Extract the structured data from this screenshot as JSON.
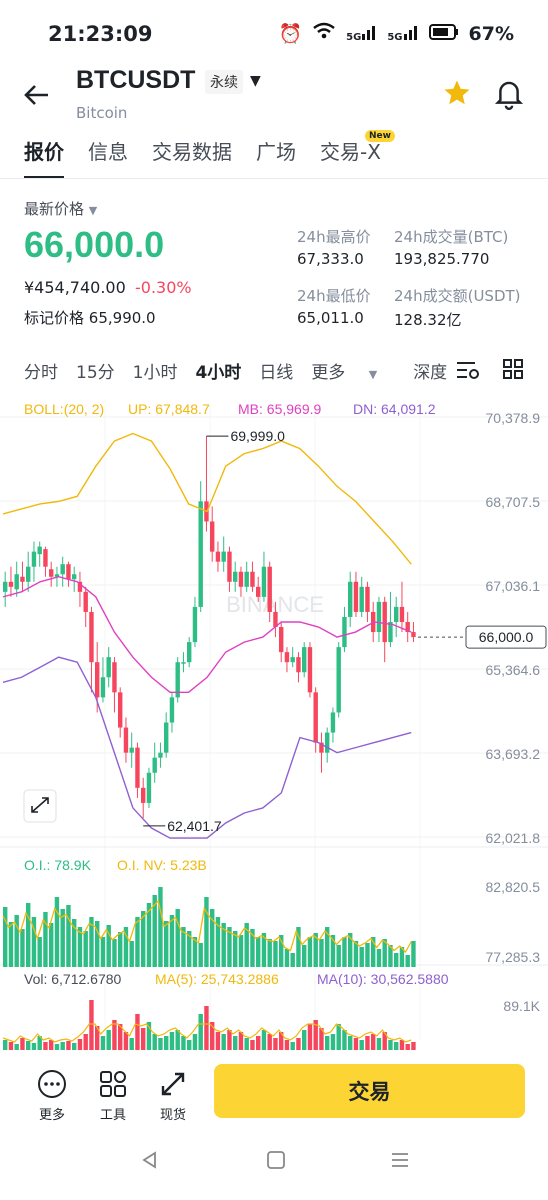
{
  "status": {
    "time": "21:23:09",
    "battery": "67%",
    "net1": "5G",
    "net2": "5G"
  },
  "header": {
    "symbol": "BTCUSDT",
    "contract_type": "永续",
    "name": "Bitcoin"
  },
  "tabs": [
    {
      "label": "报价"
    },
    {
      "label": "信息"
    },
    {
      "label": "交易数据"
    },
    {
      "label": "广场"
    },
    {
      "label": "交易-X"
    }
  ],
  "new_badge": "New",
  "price": {
    "label": "最新价格",
    "last": "66,000.0",
    "cny": "¥454,740.00",
    "change": "-0.30%",
    "mark_label": "标记价格",
    "mark": "65,990.0"
  },
  "stats": {
    "high_label": "24h最高价",
    "high": "67,333.0",
    "low_label": "24h最低价",
    "low": "65,011.0",
    "vol_label": "24h成交量(BTC)",
    "vol": "193,825.770",
    "amt_label": "24h成交额(USDT)",
    "amt": "128.32亿"
  },
  "timeframes": [
    "分时",
    "15分",
    "1小时",
    "4小时",
    "日线",
    "更多",
    "深度"
  ],
  "active_timeframe": "4小时",
  "chart_data": {
    "type": "candlestick",
    "boll": {
      "label": "BOLL:(20, 2)",
      "up": "UP: 67,848.7",
      "mb": "MB: 65,969.9",
      "dn": "DN: 64,091.2"
    },
    "y_ticks": [
      "70,378.9",
      "68,707.5",
      "67,036.1",
      "65,364.6",
      "63,693.2",
      "62,021.8"
    ],
    "ylim": [
      62021.8,
      70378.9
    ],
    "price_marker": "66,000.0",
    "high_annotation": "69,999.0",
    "low_annotation": "62,401.7",
    "watermark": "BINANCE",
    "oi": {
      "oi_label": "O.I.: 78.9K",
      "nv_label": "O.I. NV: 5.23B",
      "ticks": [
        "82,820.5",
        "77,285.3"
      ]
    },
    "volume": {
      "vol_label": "Vol: 6,712.6780",
      "ma5_label": "MA(5): 25,743.2886",
      "ma10_label": "MA(10): 30,562.5880",
      "tick": "89.1K"
    },
    "colors": {
      "up": "#2ebd85",
      "down": "#f6465d",
      "boll_up": "#f0b90b",
      "boll_mb": "#e040c0",
      "boll_dn": "#8e60d0"
    }
  },
  "bottom": {
    "more": "更多",
    "tools": "工具",
    "spot": "现货",
    "trade": "交易"
  }
}
